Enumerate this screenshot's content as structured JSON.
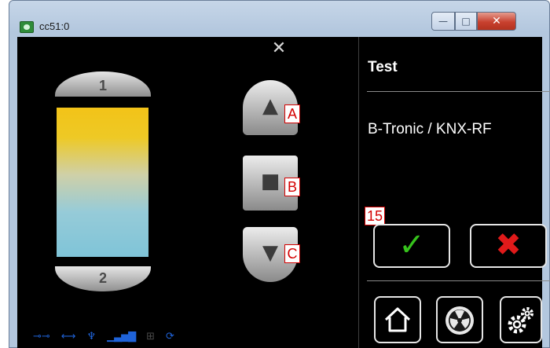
{
  "window": {
    "title": "cc51:0",
    "minimize_glyph": "—",
    "maximize_glyph": "□",
    "close_glyph": "✕"
  },
  "blind": {
    "top_label": "1",
    "bottom_label": "2"
  },
  "controls": {
    "up_icon": "triangle-up",
    "stop_icon": "square",
    "down_icon": "triangle-down",
    "up_glyph": "▲",
    "stop_glyph": "■",
    "down_glyph": "▼"
  },
  "annotations": {
    "a": "A",
    "b": "B",
    "c": "C",
    "n15": "15"
  },
  "info": {
    "title": "Test",
    "subtitle": "B-Tronic / KNX-RF"
  },
  "actions": {
    "confirm_glyph": "✓",
    "cancel_glyph": "✖"
  },
  "bottom_nav": [
    "home-icon",
    "fan-icon",
    "settings-icon"
  ],
  "status_icons": [
    "key-icon",
    "link-icon",
    "antenna-icon",
    "signal-icon",
    "network-icon",
    "sync-icon"
  ],
  "colors": {
    "confirm": "#36c21c",
    "cancel": "#e01a1a",
    "status_blue": "#1f63d9",
    "annotation_red": "#d40000"
  }
}
